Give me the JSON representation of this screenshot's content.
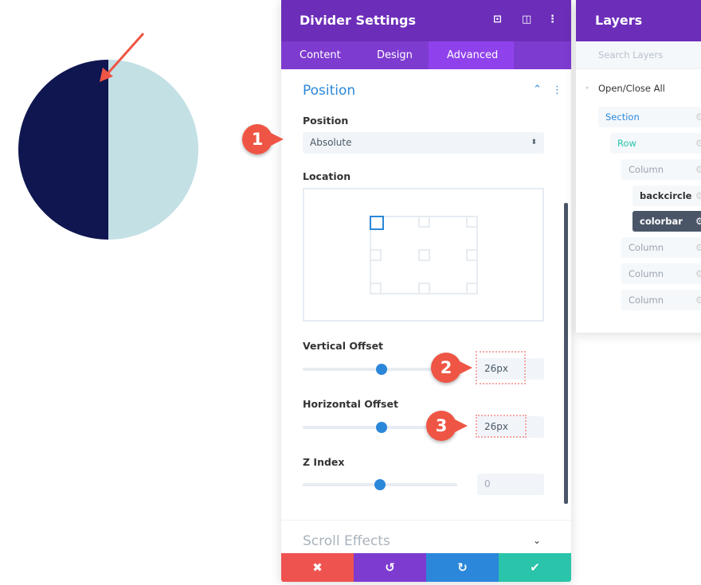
{
  "colors": {
    "header": "#6c2eb9",
    "tabs": "#7e3bd0",
    "accent": "#2b87da",
    "circle_dark": "#0f1650",
    "circle_light": "#c3e0e5",
    "cancel": "#ef5350",
    "undo": "#7e3bd0",
    "redo": "#2b87da",
    "save": "#29c4a9",
    "badge": "#ef5544"
  },
  "settings": {
    "title": "Divider Settings",
    "icons": [
      "focus-icon",
      "split-view-icon",
      "more-vertical-icon"
    ],
    "tabs": [
      {
        "label": "Content"
      },
      {
        "label": "Design"
      },
      {
        "label": "Advanced",
        "active": true
      }
    ],
    "section_title": "Position",
    "position": {
      "label": "Position",
      "value": "Absolute"
    },
    "location": {
      "label": "Location",
      "selected": "top-left"
    },
    "vertical_offset": {
      "label": "Vertical Offset",
      "value": "26px",
      "slider_percent": 50
    },
    "horizontal_offset": {
      "label": "Horizontal Offset",
      "value": "26px",
      "slider_percent": 50
    },
    "z_index": {
      "label": "Z Index",
      "value": "0",
      "slider_percent": 50
    },
    "scroll_effects": "Scroll Effects",
    "footer": {
      "cancel": "✖",
      "undo": "↺",
      "redo": "↻",
      "save": "✔"
    }
  },
  "layers": {
    "title": "Layers",
    "search_placeholder": "Search Layers",
    "open_close": "Open/Close All",
    "items": [
      {
        "label": "Section"
      },
      {
        "label": "Row"
      },
      {
        "label": "Column"
      },
      {
        "label": "backcircle"
      },
      {
        "label": "colorbar",
        "selected": true
      },
      {
        "label": "Column"
      },
      {
        "label": "Column"
      },
      {
        "label": "Column"
      }
    ]
  },
  "badges": [
    "1",
    "2",
    "3"
  ]
}
